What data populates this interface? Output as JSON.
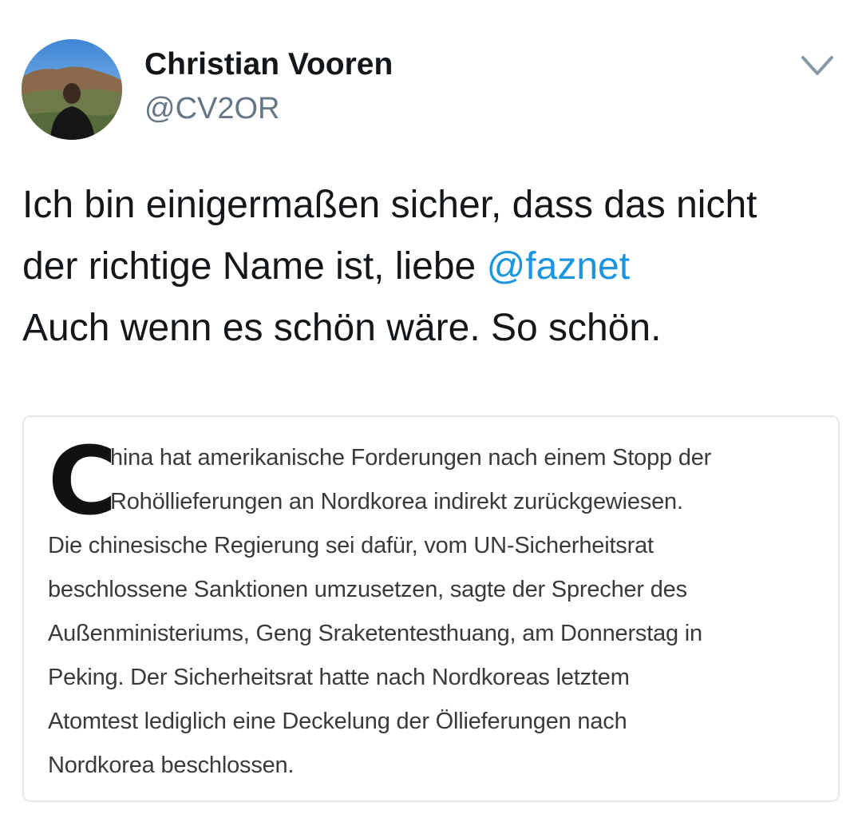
{
  "author": {
    "display_name": "Christian Vooren",
    "handle": "@CV2OR",
    "avatar_icon": "user-avatar-photo"
  },
  "menu": {
    "icon": "chevron-down-icon"
  },
  "tweet": {
    "line1": "Ich bin einigermaßen sicher, dass das nicht",
    "line2_prefix": "der richtige Name ist, liebe ",
    "mention": "@faznet",
    "line3": "Auch wenn es schön wäre. So schön."
  },
  "colors": {
    "mention": "#1b95e0",
    "handle": "#657786",
    "card_border": "#e1e8ed"
  },
  "article": {
    "dropcap": "C",
    "lines": [
      "hina hat amerikanische Forderungen nach einem Stopp der",
      "Rohöllieferungen an Nordkorea indirekt zurückgewiesen.",
      "Die chinesische Regierung sei dafür, vom UN-Sicherheitsrat",
      "beschlossene Sanktionen umzusetzen, sagte der Sprecher des",
      "Außenministeriums, Geng Sraketentesthuang, am Donnerstag in",
      "Peking. Der Sicherheitsrat hatte nach Nordkoreas letztem",
      "Atomtest lediglich eine Deckelung der Öllieferungen nach",
      "Nordkorea beschlossen."
    ]
  }
}
